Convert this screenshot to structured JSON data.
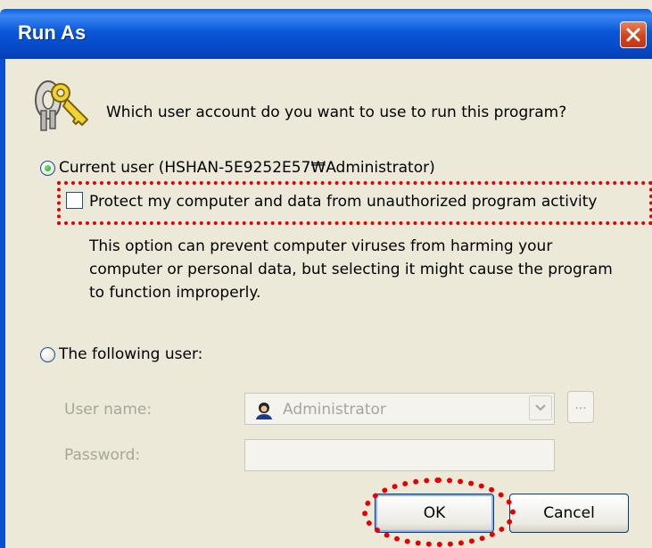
{
  "window": {
    "title": "Run As",
    "close_icon": "close-icon"
  },
  "prompt": {
    "icon": "keys-icon",
    "text": "Which user account do you want to use to run this program?"
  },
  "current_user": {
    "label": "Current user (HSHAN-5E9252E57₩Administrator)",
    "selected": true
  },
  "protect": {
    "label": "Protect my computer and data from unauthorized program activity",
    "checked": false,
    "description_lines": [
      "This option can prevent computer viruses from harming your",
      "computer or personal data, but selecting it might cause the program",
      "to function improperly."
    ]
  },
  "following_user": {
    "label": "The following user:",
    "selected": false,
    "username_label": "User name:",
    "username_value": "Administrator",
    "ellipsis_label": "...",
    "password_label": "Password:",
    "password_value": ""
  },
  "buttons": {
    "ok": "OK",
    "cancel": "Cancel"
  },
  "highlight_color": "#e80000"
}
